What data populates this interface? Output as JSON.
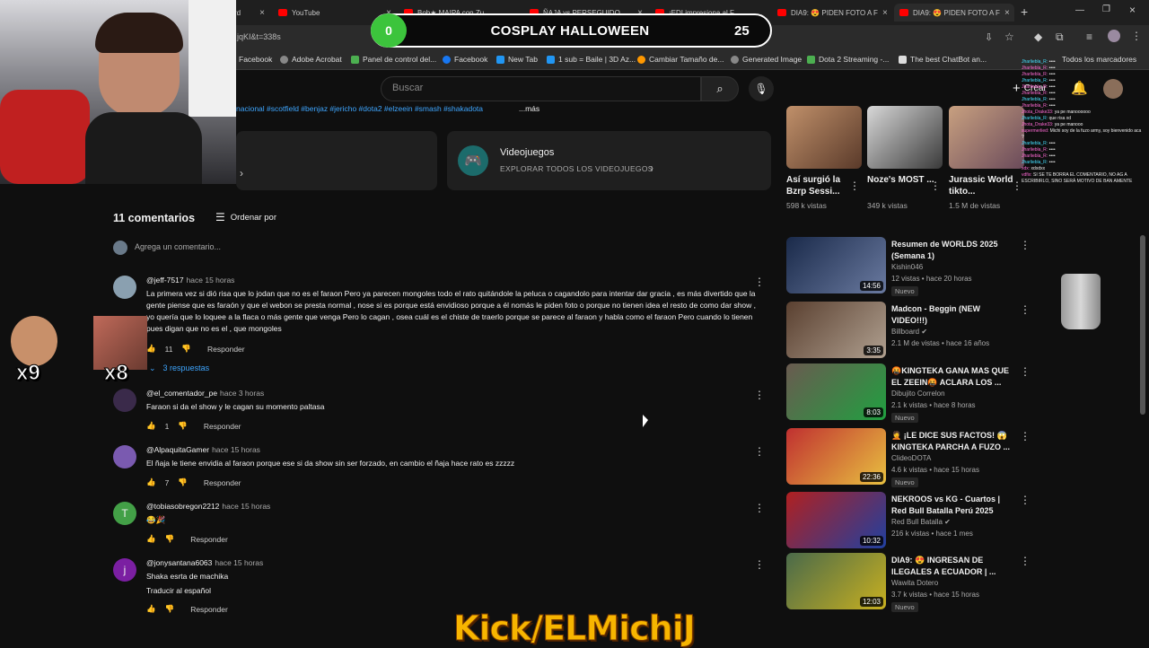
{
  "browser": {
    "tabs": [
      {
        "label": "rd"
      },
      {
        "label": "YouTube"
      },
      {
        "label": "Bob★ MAIPA con Zu..."
      },
      {
        "label": "ÑAJA vs PERSEGUIDO..."
      },
      {
        "label": "¡EDI impresiona al F..."
      },
      {
        "label": "DIA9: 😍 PIDEN FOTO A F"
      },
      {
        "label": "DIA9: 😍 PIDEN FOTO A F"
      }
    ],
    "url_fragment": "jqKI&t=338s",
    "bookmarks": [
      "Facebook",
      "Adobe Acrobat",
      "Panel de control del...",
      "Facebook",
      "New Tab",
      "1 sub = Baile | 3D Az...",
      "Cambiar Tamaño de...",
      "Generated Image",
      "Dota 2 Streaming -...",
      "The best ChatBot an...",
      "Todos los marcadores"
    ]
  },
  "youtube": {
    "search_placeholder": "Buscar",
    "create_label": "Crear",
    "hashtags": "nacional #scotfield #benjaz #jericho #dota2 #elzeein #smash #shakadota",
    "more_label": "...más",
    "games_card": {
      "title": "Videojuegos",
      "subtitle": "EXPLORAR TODOS LOS VIDEOJUEGOS"
    },
    "comments_count": "11 comentarios",
    "sort_label": "Ordenar por",
    "add_comment_placeholder": "Agrega un comentario...",
    "reply_label": "Responder",
    "comments": [
      {
        "author": "@jeff-7517",
        "time": "hace 15 horas",
        "text": "La primera vez si dió risa que lo jodan que no es el faraon Pero ya parecen mongoles todo el rato quitándole la peluca o cagandolo para intentar dar gracia , es más divertido que la gente piense que es faraón y que el webon se presta normal , nose si es porque está envidioso porque a él nomás le piden foto o porque no tienen idea el resto de como dar show , yo quería que lo loquee a la flaca o más gente que venga Pero lo cagan , osea cuál es el chiste de traerlo porque se parece al faraon y habla como el faraon Pero cuando lo tienen pues digan que no es el , que mongoles",
        "likes": "11",
        "replies": "3 respuestas"
      },
      {
        "author": "@el_comentador_pe",
        "time": "hace 3 horas",
        "text": "Faraon si da el show y le cagan su momento paltasa",
        "likes": "1"
      },
      {
        "author": "@AlpaquitaGamer",
        "time": "hace 15 horas",
        "text": "El ñaja le tiene envidia al faraon porque ese si da show sin ser forzado, en cambio el ñaja hace rato es zzzzz",
        "likes": "7"
      },
      {
        "author": "@tobiasobregon2212",
        "time": "hace 15 horas",
        "text": "😂🎉",
        "likes": "",
        "initial": "T"
      },
      {
        "author": "@jonysantana6063",
        "time": "hace 15 horas",
        "text": "Shaka esrta de machika",
        "translate": "Traducir al español",
        "likes": "",
        "initial": "j"
      }
    ],
    "shorts": [
      {
        "title": "Así surgió la Bzrp Sessi...",
        "views": "598 k vistas"
      },
      {
        "title": "Noze's MOST ...",
        "views": "349 k vistas"
      },
      {
        "title": "Jurassic World tikto...",
        "views": "1.5 M de vistas"
      }
    ],
    "related": [
      {
        "title": "Resumen de WORLDS 2025 (Semana 1)",
        "channel": "Kishin046",
        "meta": "12 vistas • hace 20 horas",
        "badge": "Nuevo",
        "duration": "14:56"
      },
      {
        "title": "Madcon - Beggin (NEW VIDEO!!!)",
        "channel": "Billboard",
        "meta": "2.1 M de vistas • hace 16 años",
        "badge": "",
        "duration": "3:35"
      },
      {
        "title": "🤬KINGTEKA GANA MAS QUE EL ZEEIN🤬 ACLARA LOS ...",
        "channel": "Dibujito Correlon",
        "meta": "2.1 k vistas • hace 8 horas",
        "badge": "Nuevo",
        "duration": "8:03"
      },
      {
        "title": "🤦 ¡LE DICE SUS FACTOS! 😱 KINGTEKA PARCHA A FUZO ...",
        "channel": "ClideoDOTA",
        "meta": "4.6 k vistas • hace 15 horas",
        "badge": "Nuevo",
        "duration": "22:36"
      },
      {
        "title": "NEKROOS vs KG - Cuartos | Red Bull Batalla Perú 2025",
        "channel": "Red Bull Batalla",
        "meta": "216 k vistas • hace 1 mes",
        "badge": "",
        "duration": "10:32"
      },
      {
        "title": "DIA9: 😍 INGRESAN DE ILEGALES A ECUADOR | ...",
        "channel": "Wawita Dotero",
        "meta": "3.7 k vistas • hace 15 horas",
        "badge": "Nuevo",
        "duration": "12:03"
      }
    ]
  },
  "overlay": {
    "left_count": "0",
    "title": "COSPLAY HALLOWEEN",
    "right_count": "25",
    "kick_banner": "Kick/ELMichiJ",
    "multiplier_1": "x9",
    "multiplier_2": "x8"
  },
  "chat_lines": [
    "Jharliebla_R: ••••",
    "Jharliebla_R: ••••",
    "Jharliebla_R: ••••",
    "Jharliebla_R: ••••",
    "Jharliebla_R: ••••",
    "Jharliebla_R: ••••",
    "Jharliebla_R: ••••",
    "Jharliebla_R: ••••",
    "Jhota_Drake33: ya pe manoooooo",
    "Jharliebla_R: que risa xd",
    "Jhota_Drake33: ya pe manooo",
    "supermerlied: Michi soy de la fuzo army, soy bienvenido aca ?",
    "Jharliebla_R: ••••",
    "Jharliebla_R: ••••",
    "Jharliebla_R: ••••",
    "Jharliebla_R: ••••",
    "xdx: xdxdxx",
    "vdfix: SI SE TE BORRA EL COMENTARIO, NO AG A ESCRIBIRLO, SINO SERÁ MOTIVO DE BAN AMENTE"
  ]
}
